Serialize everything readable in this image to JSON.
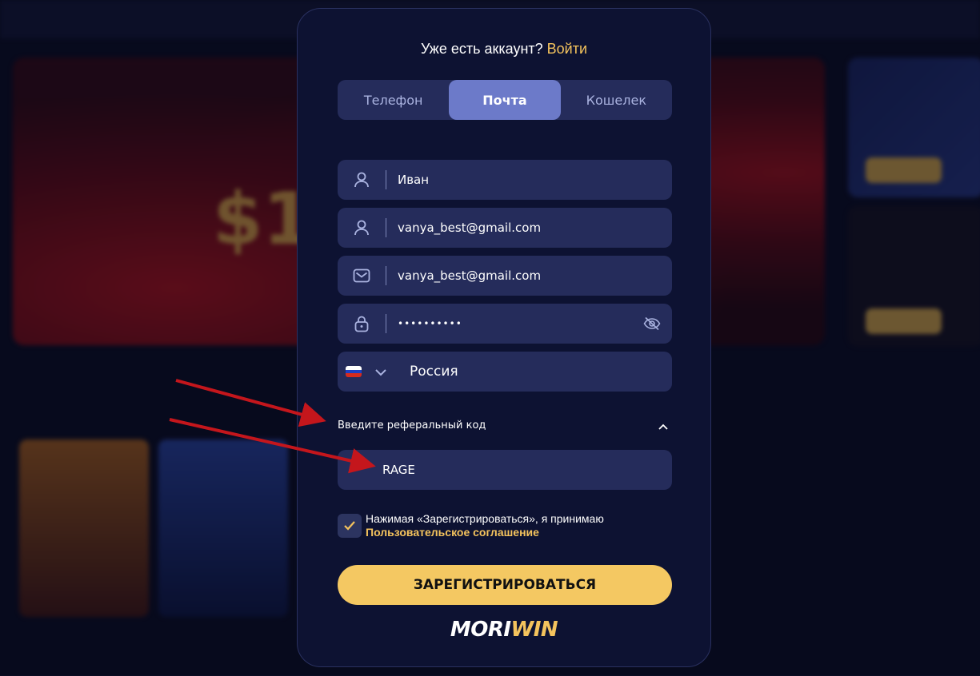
{
  "header": {
    "have_account_text": "Уже есть аккаунт?",
    "login_link": "Войти"
  },
  "tabs": [
    {
      "label": "Телефон",
      "active": false
    },
    {
      "label": "Почта",
      "active": true
    },
    {
      "label": "Кошелек",
      "active": false
    }
  ],
  "form": {
    "name_value": "Иван",
    "username_value": "vanya_best@gmail.com",
    "email_value": "vanya_best@gmail.com",
    "password_value": "••••••••••",
    "country_value": "Россия",
    "referral_label": "Введите реферальный код",
    "referral_value": "RAGE"
  },
  "terms": {
    "text": "Нажимая «Зарегистрироваться», я принимаю",
    "link": "Пользовательское соглашение",
    "checked": true
  },
  "submit_label": "ЗАРЕГИСТРИРОВАТЬСЯ",
  "brand": {
    "part1": "MORI",
    "part2": "WIN"
  },
  "colors": {
    "accent": "#f4c35d",
    "modal_bg": "#0d1232",
    "field_bg": "#252c5b",
    "active_tab": "#6c7ac9",
    "annotation_arrow": "#c4161c"
  }
}
